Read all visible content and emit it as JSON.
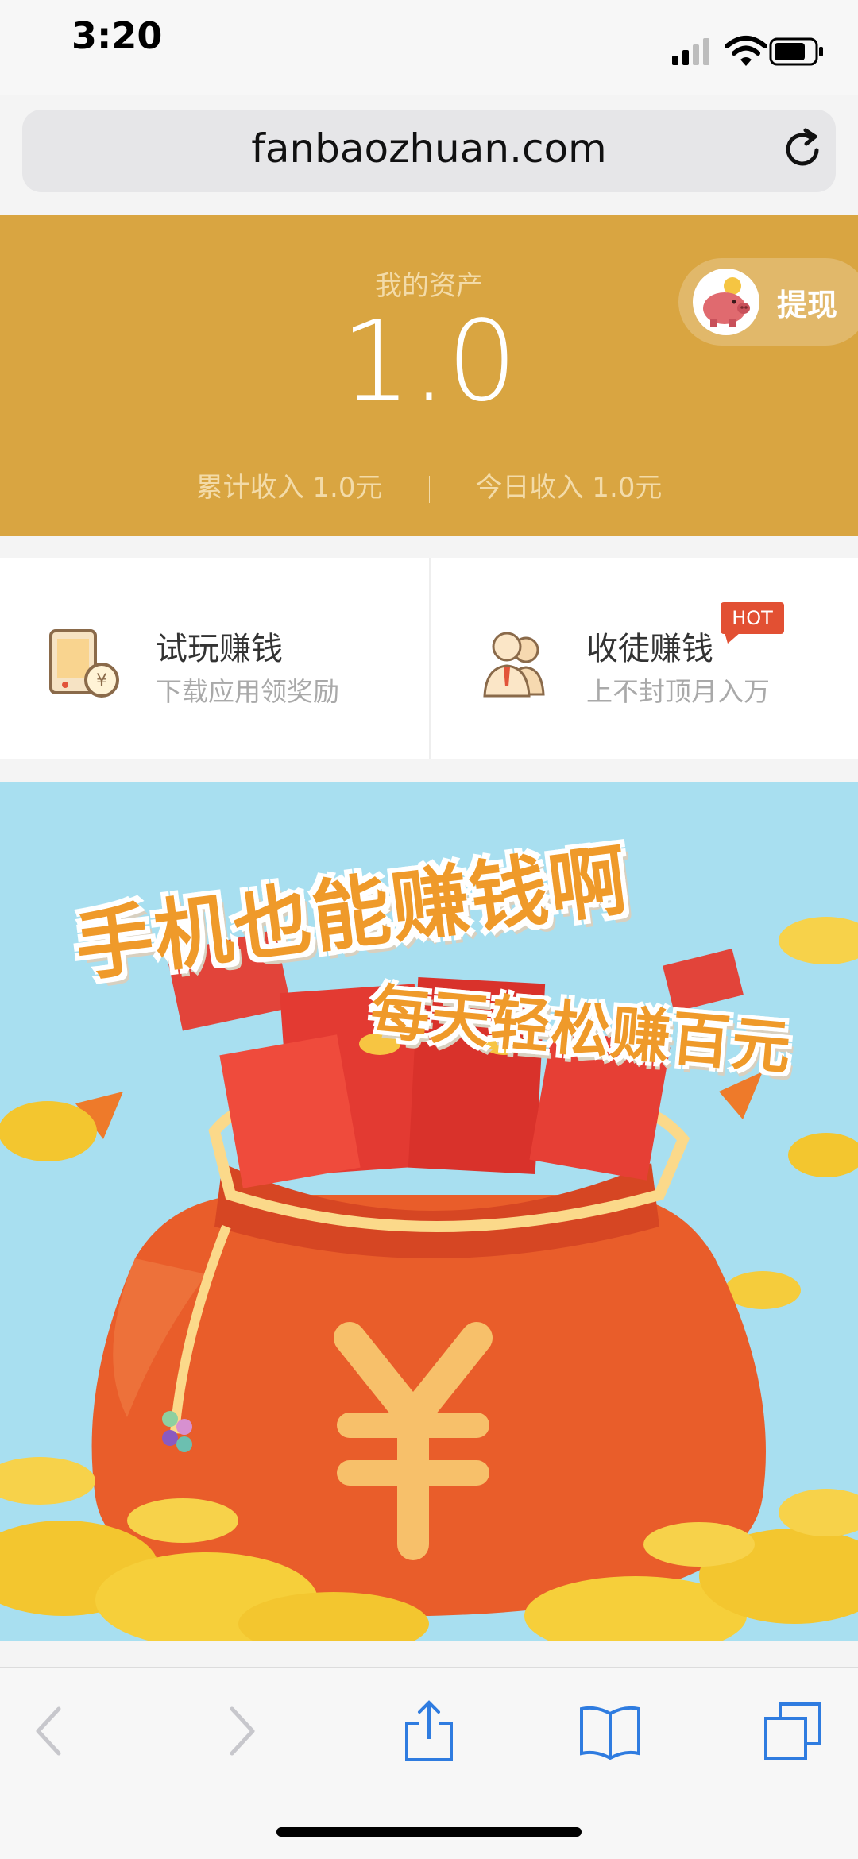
{
  "status_bar": {
    "time": "3:20"
  },
  "browser": {
    "url": "fanbaozhuan.com"
  },
  "assets": {
    "label": "我的资产",
    "value": "1.0",
    "total_income": "累计收入 1.0元",
    "today_income": "今日收入 1.0元",
    "withdraw_label": "提现"
  },
  "features": [
    {
      "title": "试玩赚钱",
      "subtitle": "下载应用领奖励",
      "icon": "phone-coin-icon"
    },
    {
      "title": "收徒赚钱",
      "subtitle": "上不封顶月入万",
      "icon": "people-icon",
      "badge": "HOT"
    }
  ],
  "banner": {
    "line1": "手机也能赚钱啊",
    "line2": "每天轻松赚百元"
  },
  "colors": {
    "header_gold": "#d9a541",
    "banner_sky": "#a8dff0",
    "hot_badge": "#e25033",
    "toolbar_blue": "#2f7ce0"
  }
}
